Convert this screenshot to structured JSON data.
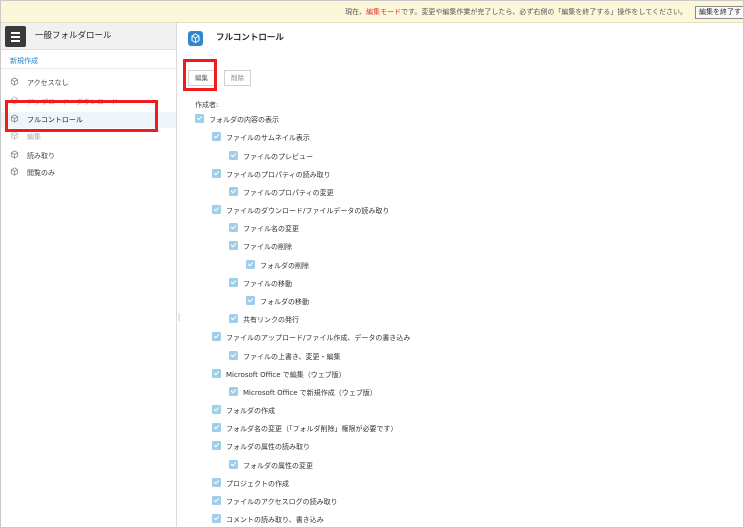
{
  "notice": {
    "prefix": "現在、",
    "mode": "編集モード",
    "suffix": "です。変更や編集作業が完了したら、必ず右側の「編集を終了する」操作をしてください。",
    "exit_button": "編集を終了す"
  },
  "sidebar": {
    "title": "一般フォルダロール",
    "new_link": "新規作成",
    "items": [
      {
        "label": "アクセスなし",
        "icon": "role-icon"
      },
      {
        "label": "アップロード・ダウンロード",
        "icon": "role-icon"
      },
      {
        "label": "フルコントロール",
        "icon": "role-icon"
      },
      {
        "label": "編集",
        "icon": "role-icon"
      },
      {
        "label": "読み取り",
        "icon": "role-icon"
      },
      {
        "label": "閲覧のみ",
        "icon": "role-icon"
      }
    ]
  },
  "main": {
    "title": "フルコントロール",
    "edit_button": "編集",
    "delete_button": "削除",
    "creator_label": "作成者:",
    "permissions": [
      {
        "label": "フォルダの内容の表示",
        "level": 0
      },
      {
        "label": "ファイルのサムネイル表示",
        "level": 1
      },
      {
        "label": "ファイルのプレビュー",
        "level": 2
      },
      {
        "label": "ファイルのプロパティの読み取り",
        "level": 1
      },
      {
        "label": "ファイルのプロパティの変更",
        "level": 2
      },
      {
        "label": "ファイルのダウンロード/ファイルデータの読み取り",
        "level": 1
      },
      {
        "label": "ファイル名の変更",
        "level": 2
      },
      {
        "label": "ファイルの削除",
        "level": 2
      },
      {
        "label": "フォルダの削除",
        "level": 3
      },
      {
        "label": "ファイルの移動",
        "level": 2
      },
      {
        "label": "フォルダの移動",
        "level": 3
      },
      {
        "label": "共有リンクの発行",
        "level": 2
      },
      {
        "label": "ファイルのアップロード/ファイル作成、データの書き込み",
        "level": 1
      },
      {
        "label": "ファイルの上書き、変更・編集",
        "level": 2
      },
      {
        "label": "Microsoft Office で編集（ウェブ版）",
        "level": 1
      },
      {
        "label": "Microsoft Office で新規作成（ウェブ版）",
        "level": 2
      },
      {
        "label": "フォルダの作成",
        "level": 1
      },
      {
        "label": "フォルダ名の変更（「フォルダ削除」権限が必要です）",
        "level": 1
      },
      {
        "label": "フォルダの属性の読み取り",
        "level": 1
      },
      {
        "label": "フォルダの属性の変更",
        "level": 2
      },
      {
        "label": "プロジェクトの作成",
        "level": 1
      },
      {
        "label": "ファイルのアクセスログの読み取り",
        "level": 1
      },
      {
        "label": "コメントの読み取り、書き込み",
        "level": 1
      }
    ]
  },
  "colors": {
    "accent": "#2f88cf",
    "link": "#1a86d0",
    "mode_text": "#e0312a",
    "checkbox": "#9fcdea",
    "highlight": "#ee1c1c",
    "notice_bg": "#fdf7da"
  }
}
